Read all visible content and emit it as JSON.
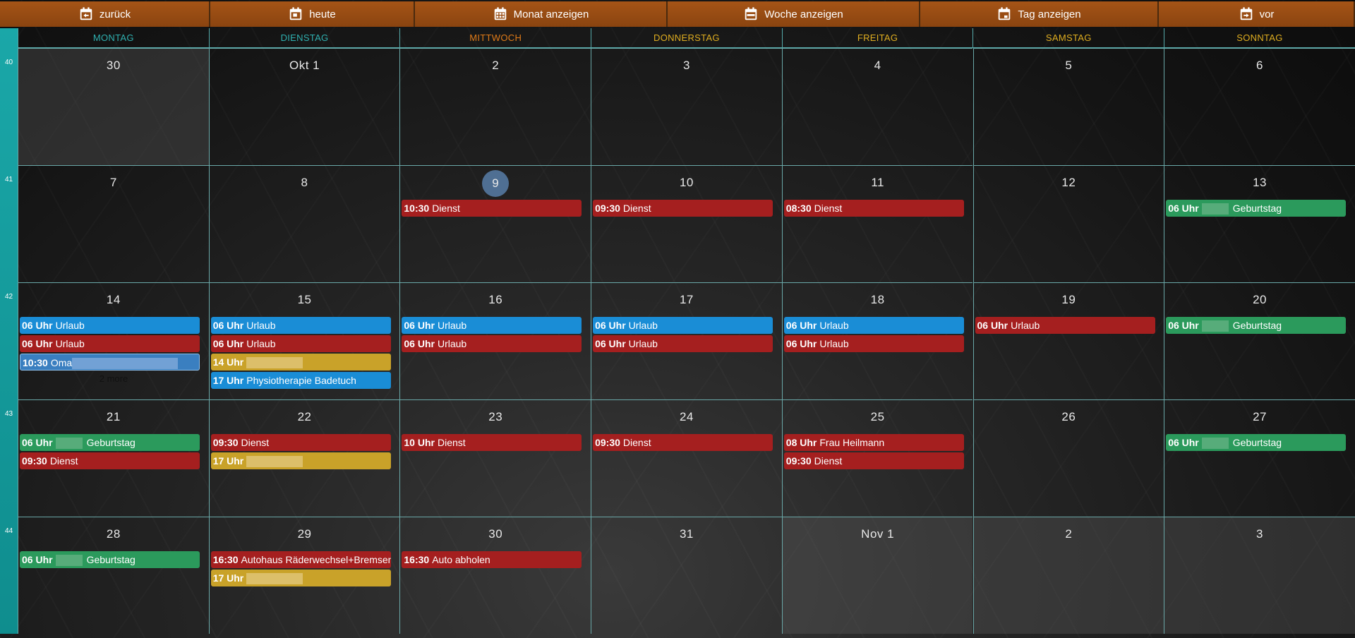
{
  "colors": {
    "toolbar": "#9a4d13",
    "header_monday": "#2fb0b0",
    "header_tuesday": "#2fb0b0",
    "header_wednesday": "#e07b18",
    "header_other": "#e0ae20",
    "weeknum_bg": "#13999a",
    "today": "#4f6f93",
    "event_blue": "#1a8dd6",
    "event_red": "#a51f1f",
    "event_yellow": "#c9a229",
    "event_green": "#2b9a5c",
    "event_blue_light": "#3a7fc0"
  },
  "toolbar": {
    "buttons": [
      {
        "label": "zurück",
        "icon": "calendar-arrow-left-icon"
      },
      {
        "label": "heute",
        "icon": "calendar-today-icon"
      },
      {
        "label": "Monat anzeigen",
        "icon": "calendar-month-icon"
      },
      {
        "label": "Woche anzeigen",
        "icon": "calendar-week-icon"
      },
      {
        "label": "Tag anzeigen",
        "icon": "calendar-day-icon"
      },
      {
        "label": "vor",
        "icon": "calendar-arrow-right-icon"
      }
    ]
  },
  "headers": [
    "MONTAG",
    "DIENSTAG",
    "MITTWOCH",
    "DONNERSTAG",
    "FREITAG",
    "SAMSTAG",
    "SONNTAG"
  ],
  "weeks": [
    {
      "num": "40",
      "days": [
        {
          "label": "30",
          "other": true,
          "events": []
        },
        {
          "label": "Okt 1",
          "events": []
        },
        {
          "label": "2",
          "events": []
        },
        {
          "label": "3",
          "events": []
        },
        {
          "label": "4",
          "events": []
        },
        {
          "label": "5",
          "events": []
        },
        {
          "label": "6",
          "events": []
        }
      ]
    },
    {
      "num": "41",
      "days": [
        {
          "label": "7",
          "events": []
        },
        {
          "label": "8",
          "events": []
        },
        {
          "label": "9",
          "today": true,
          "events": [
            {
              "time": "10:30",
              "title": "Dienst",
              "color": "red"
            }
          ]
        },
        {
          "label": "10",
          "events": [
            {
              "time": "09:30",
              "title": "Dienst",
              "color": "red"
            }
          ]
        },
        {
          "label": "11",
          "events": [
            {
              "time": "08:30",
              "title": "Dienst",
              "color": "red"
            }
          ]
        },
        {
          "label": "12",
          "events": []
        },
        {
          "label": "13",
          "events": [
            {
              "time": "06 Uhr",
              "title": "Geburtstag",
              "color": "green",
              "blur": true
            }
          ]
        }
      ]
    },
    {
      "num": "42",
      "days": [
        {
          "label": "14",
          "more": "2 more",
          "events": [
            {
              "time": "06 Uhr",
              "title": "Urlaub",
              "color": "blue"
            },
            {
              "time": "06 Uhr",
              "title": "Urlaub",
              "color": "red"
            },
            {
              "time": "10:30",
              "title": "Oma",
              "color": "bluelight",
              "blur": true
            }
          ]
        },
        {
          "label": "15",
          "events": [
            {
              "time": "06 Uhr",
              "title": "Urlaub",
              "color": "blue"
            },
            {
              "time": "06 Uhr",
              "title": "Urlaub",
              "color": "red"
            },
            {
              "time": "14 Uhr",
              "title": "",
              "color": "yellow",
              "blur": true
            },
            {
              "time": "17 Uhr",
              "title": "Physiotherapie Badetuch",
              "color": "blue"
            }
          ]
        },
        {
          "label": "16",
          "events": [
            {
              "time": "06 Uhr",
              "title": "Urlaub",
              "color": "blue"
            },
            {
              "time": "06 Uhr",
              "title": "Urlaub",
              "color": "red"
            }
          ]
        },
        {
          "label": "17",
          "events": [
            {
              "time": "06 Uhr",
              "title": "Urlaub",
              "color": "blue"
            },
            {
              "time": "06 Uhr",
              "title": "Urlaub",
              "color": "red"
            }
          ]
        },
        {
          "label": "18",
          "events": [
            {
              "time": "06 Uhr",
              "title": "Urlaub",
              "color": "blue"
            },
            {
              "time": "06 Uhr",
              "title": "Urlaub",
              "color": "red"
            }
          ]
        },
        {
          "label": "19",
          "events": [
            {
              "time": "06 Uhr",
              "title": "Urlaub",
              "color": "red"
            }
          ]
        },
        {
          "label": "20",
          "events": [
            {
              "time": "06 Uhr",
              "title": "Geburtstag",
              "color": "green",
              "blur": true
            }
          ]
        }
      ]
    },
    {
      "num": "43",
      "days": [
        {
          "label": "21",
          "events": [
            {
              "time": "06 Uhr",
              "title": "Geburtstag",
              "color": "green",
              "blur": true
            },
            {
              "time": "09:30",
              "title": "Dienst",
              "color": "red"
            }
          ]
        },
        {
          "label": "22",
          "events": [
            {
              "time": "09:30",
              "title": "Dienst",
              "color": "red"
            },
            {
              "time": "17 Uhr",
              "title": "",
              "color": "yellow",
              "blur": true
            }
          ]
        },
        {
          "label": "23",
          "events": [
            {
              "time": "10 Uhr",
              "title": "Dienst",
              "color": "red"
            }
          ]
        },
        {
          "label": "24",
          "events": [
            {
              "time": "09:30",
              "title": "Dienst",
              "color": "red"
            }
          ]
        },
        {
          "label": "25",
          "events": [
            {
              "time": "08 Uhr",
              "title": "Frau Heilmann",
              "color": "red"
            },
            {
              "time": "09:30",
              "title": "Dienst",
              "color": "red"
            }
          ]
        },
        {
          "label": "26",
          "events": []
        },
        {
          "label": "27",
          "events": [
            {
              "time": "06 Uhr",
              "title": "Geburtstag",
              "color": "green",
              "blur": true
            }
          ]
        }
      ]
    },
    {
      "num": "44",
      "days": [
        {
          "label": "28",
          "events": [
            {
              "time": "06 Uhr",
              "title": "Geburtstag",
              "color": "green",
              "blur": true
            }
          ]
        },
        {
          "label": "29",
          "events": [
            {
              "time": "16:30",
              "title": "Autohaus Räderwechsel+Bremsen",
              "color": "red"
            },
            {
              "time": "17 Uhr",
              "title": "",
              "color": "yellow",
              "blur": true
            }
          ]
        },
        {
          "label": "30",
          "events": [
            {
              "time": "16:30",
              "title": "Auto abholen",
              "color": "red"
            }
          ]
        },
        {
          "label": "31",
          "events": []
        },
        {
          "label": "Nov 1",
          "other": true,
          "events": []
        },
        {
          "label": "2",
          "other": true,
          "events": []
        },
        {
          "label": "3",
          "other": true,
          "events": []
        }
      ]
    }
  ]
}
